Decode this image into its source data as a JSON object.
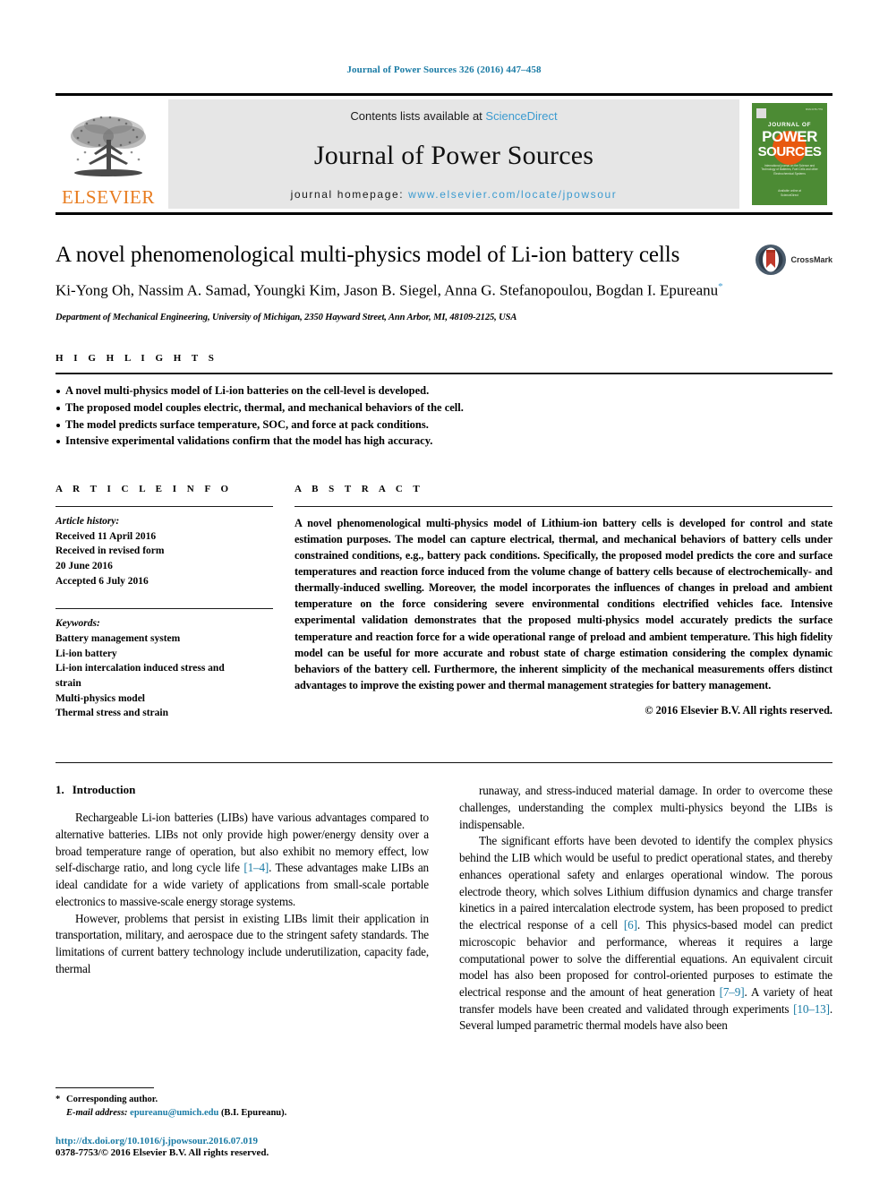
{
  "running_head": "Journal of Power Sources 326 (2016) 447–458",
  "banner": {
    "publisher_logo_text": "ELSEVIER",
    "contents_prefix": "Contents lists available at ",
    "contents_link": "ScienceDirect",
    "journal_name": "Journal of Power Sources",
    "homepage_prefix": "journal homepage: ",
    "homepage_url": "www.elsevier.com/locate/jpowsour",
    "cover": {
      "line1": "JOURNAL OF",
      "line2": "POWER",
      "line3": "SOURCES",
      "blurb": "International journal on the Science and Technology of Batteries, Fuel Cells and other Electrochemical Systems",
      "foot": "Available online at\nScienceDirect"
    }
  },
  "article": {
    "title": "A novel phenomenological multi-physics model of Li-ion battery cells",
    "authors": "Ki-Yong Oh, Nassim A. Samad, Youngki Kim, Jason B. Siegel, Anna G. Stefanopoulou, Bogdan I. Epureanu",
    "author_star": "*",
    "affiliation": "Department of Mechanical Engineering, University of Michigan, 2350 Hayward Street, Ann Arbor, MI, 48109-2125, USA",
    "crossmark_label": "CrossMark"
  },
  "highlights": {
    "label": "H I G H L I G H T S",
    "items": [
      "A novel multi-physics model of Li-ion batteries on the cell-level is developed.",
      "The proposed model couples electric, thermal, and mechanical behaviors of the cell.",
      "The model predicts surface temperature, SOC, and force at pack conditions.",
      "Intensive experimental validations confirm that the model has high accuracy."
    ]
  },
  "article_info": {
    "label": "A R T I C L E   I N F O",
    "history_label": "Article history:",
    "history": [
      "Received 11 April 2016",
      "Received in revised form",
      "20 June 2016",
      "Accepted 6 July 2016"
    ],
    "keywords_label": "Keywords:",
    "keywords": [
      "Battery management system",
      "Li-ion battery",
      "Li-ion intercalation induced stress and",
      "strain",
      "Multi-physics model",
      "Thermal stress and strain"
    ]
  },
  "abstract": {
    "label": "A B S T R A C T",
    "text": "A novel phenomenological multi-physics model of Lithium-ion battery cells is developed for control and state estimation purposes. The model can capture electrical, thermal, and mechanical behaviors of battery cells under constrained conditions, e.g., battery pack conditions. Specifically, the proposed model predicts the core and surface temperatures and reaction force induced from the volume change of battery cells because of electrochemically- and thermally-induced swelling. Moreover, the model incorporates the influences of changes in preload and ambient temperature on the force considering severe environmental conditions electrified vehicles face. Intensive experimental validation demonstrates that the proposed multi-physics model accurately predicts the surface temperature and reaction force for a wide operational range of preload and ambient temperature. This high fidelity model can be useful for more accurate and robust state of charge estimation considering the complex dynamic behaviors of the battery cell. Furthermore, the inherent simplicity of the mechanical measurements offers distinct advantages to improve the existing power and thermal management strategies for battery management.",
    "copyright": "© 2016 Elsevier B.V. All rights reserved."
  },
  "body": {
    "section_number": "1.",
    "section_title": "Introduction",
    "left_paragraphs": [
      "Rechargeable Li-ion batteries (LIBs) have various advantages compared to alternative batteries. LIBs not only provide high power/energy density over a broad temperature range of operation, but also exhibit no memory effect, low self-discharge ratio, and long cycle life [1–4]. These advantages make LIBs an ideal candidate for a wide variety of applications from small-scale portable electronics to massive-scale energy storage systems.",
      "However, problems that persist in existing LIBs limit their application in transportation, military, and aerospace due to the stringent safety standards. The limitations of current battery technology include underutilization, capacity fade, thermal"
    ],
    "right_paragraphs": [
      "runaway, and stress-induced material damage. In order to overcome these challenges, understanding the complex multi-physics beyond the LIBs is indispensable.",
      "The significant efforts have been devoted to identify the complex physics behind the LIB which would be useful to predict operational states, and thereby enhances operational safety and enlarges operational window. The porous electrode theory, which solves Lithium diffusion dynamics and charge transfer kinetics in a paired intercalation electrode system, has been proposed to predict the electrical response of a cell [6]. This physics-based model can predict microscopic behavior and performance, whereas it requires a large computational power to solve the differential equations. An equivalent circuit model has also been proposed for control-oriented purposes to estimate the electrical response and the amount of heat generation [7–9]. A variety of heat transfer models have been created and validated through experiments [10–13]. Several lumped parametric thermal models have also been"
    ],
    "refs_left": [
      "[1–4]"
    ],
    "refs_right": [
      "[6]",
      "[7–9]",
      "[10–13]"
    ]
  },
  "footnote": {
    "star": "*",
    "corresponding": "Corresponding author.",
    "email_label": "E-mail address:",
    "email": "epureanu@umich.edu",
    "email_owner": "(B.I. Epureanu).",
    "doi": "http://dx.doi.org/10.1016/j.jpowsour.2016.07.019",
    "issn": "0378-7753/© 2016 Elsevier B.V. All rights reserved."
  },
  "colors": {
    "link_blue": "#3c9bd0",
    "ref_blue": "#1a7ba5",
    "elsevier_orange": "#e87b1e",
    "cover_green": "#4c8b34",
    "cover_orange": "#e8580f",
    "banner_gray": "#e6e6e6"
  }
}
